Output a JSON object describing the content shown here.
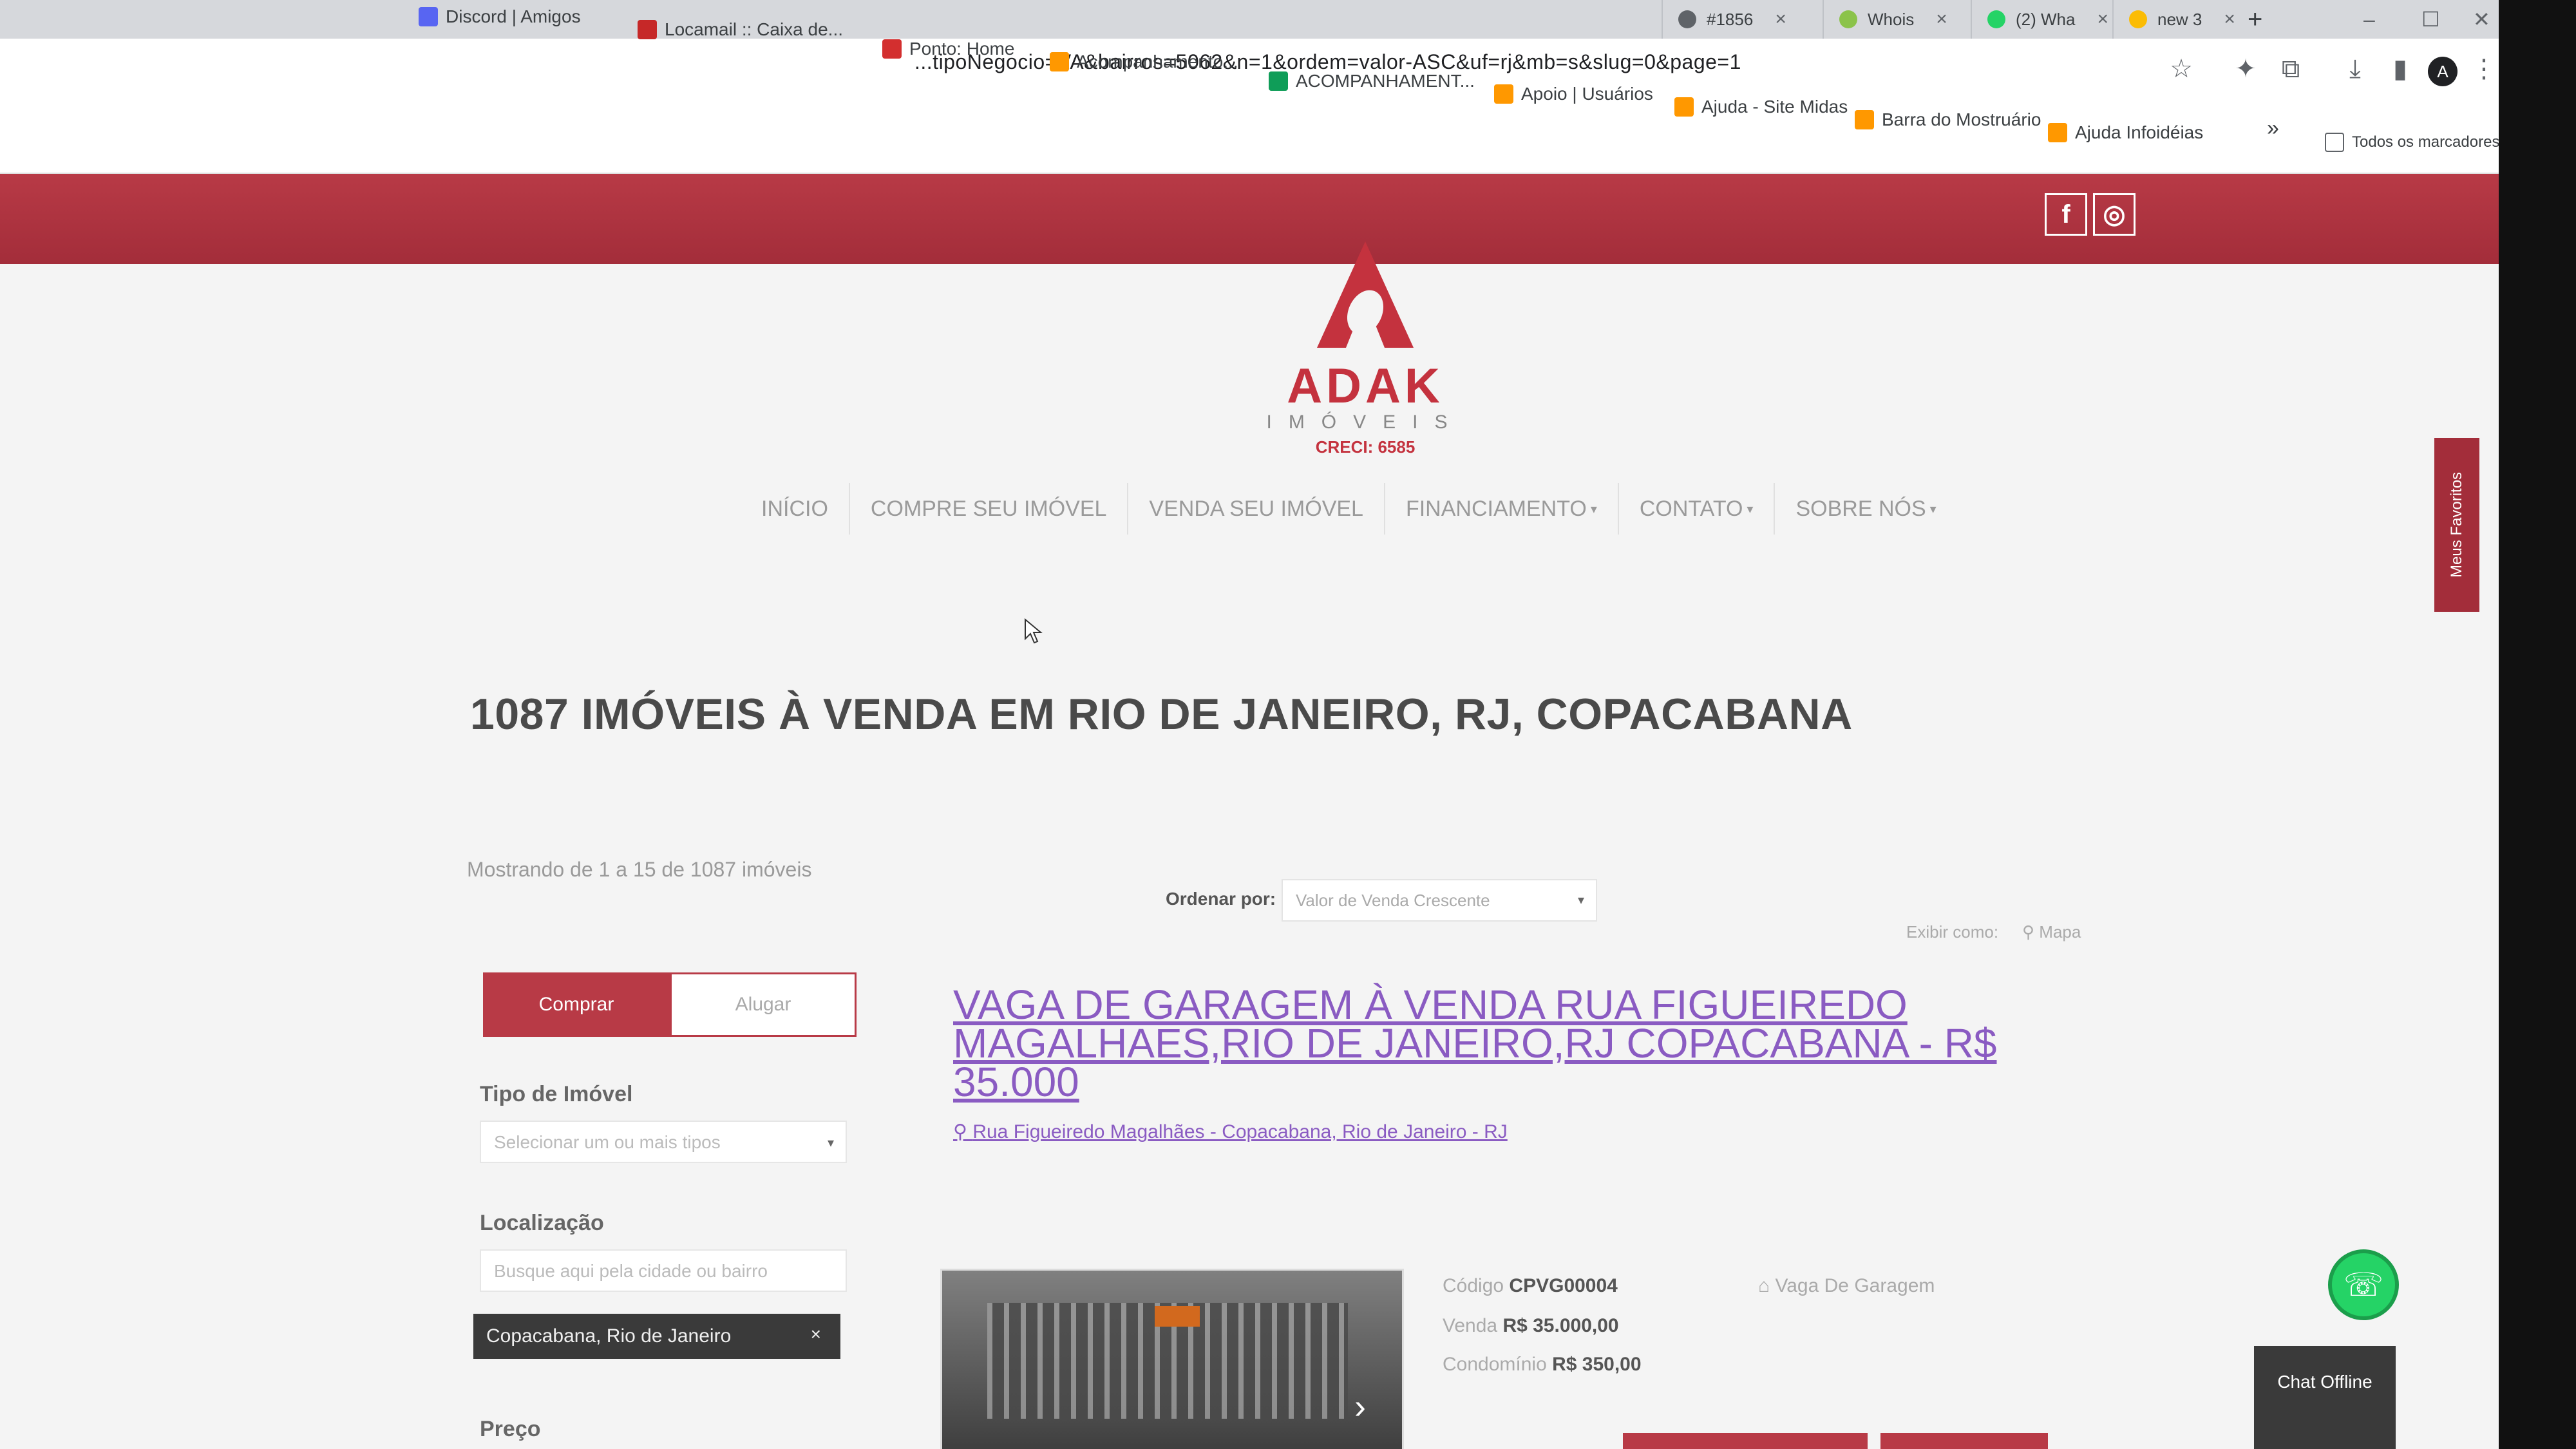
{
  "browser": {
    "tabs": [
      {
        "title": "#1856",
        "close": "×"
      },
      {
        "title": "Whois",
        "close": "×"
      },
      {
        "title": "(2) Wha",
        "close": "×"
      },
      {
        "title": "new 3",
        "close": "×"
      }
    ],
    "new_tab": "+",
    "url": "...tipoNegocio=VA&bairros=5062&n=1&ordem=valor-ASC&uf=rj&mb=s&slug=0&page=1",
    "profile_initial": "A",
    "bookmarks": [
      "Discord | Amigos",
      "Locamail :: Caixa de...",
      "Ponto: Home",
      "Acompanhamento...",
      "ACOMPANHAMENT...",
      "Apoio | Usuários",
      "Ajuda - Site Midas",
      "Barra do Mostruário",
      "Ajuda Infoidéias"
    ],
    "bookmarks_overflow": "»",
    "all_bookmarks": "Todos os marcadores"
  },
  "site": {
    "social": [
      "f",
      "◎"
    ],
    "logo": {
      "name": "ADAK",
      "sub": "IMÓVEIS",
      "creci": "CRECI: 6585"
    },
    "nav": [
      {
        "label": "INÍCIO",
        "dropdown": false
      },
      {
        "label": "COMPRE SEU IMÓVEL",
        "dropdown": false
      },
      {
        "label": "VENDA SEU IMÓVEL",
        "dropdown": false
      },
      {
        "label": "FINANCIAMENTO",
        "dropdown": true
      },
      {
        "label": "CONTATO",
        "dropdown": true
      },
      {
        "label": "SOBRE NÓS",
        "dropdown": true
      }
    ],
    "favorites_tab": "Meus Favoritos"
  },
  "results": {
    "heading": "1087 IMÓVEIS À VENDA EM RIO DE JANEIRO, RJ, COPACABANA",
    "showing": "Mostrando de 1 a 15 de 1087 imóveis",
    "sort_label": "Ordenar por:",
    "sort_value": "Valor de Venda Crescente",
    "view_label": "Exibir como:",
    "view_map": "Mapa"
  },
  "filters": {
    "buy_label": "Comprar",
    "rent_label": "Alugar",
    "type_label": "Tipo de Imóvel",
    "type_placeholder": "Selecionar um ou mais tipos",
    "location_label": "Localização",
    "location_placeholder": "Busque aqui pela cidade ou bairro",
    "location_chip": "Copacabana, Rio de Janeiro",
    "price_label": "Preço"
  },
  "listing": {
    "title": "VAGA DE GARAGEM À VENDA RUA FIGUEIREDO MAGALHAES,RIO DE JANEIRO,RJ COPACABANA - R$ 35.000",
    "address": "Rua Figueiredo Magalhães - Copacabana, Rio de Janeiro - RJ",
    "code_label": "Código",
    "code": "CPVG00004",
    "type": "Vaga De Garagem",
    "sale_label": "Venda",
    "sale_price": "R$ 35.000,00",
    "condo_label": "Condomínio",
    "condo_price": "R$ 350,00"
  },
  "widgets": {
    "chat": "Chat Offline"
  },
  "colors": {
    "brand_red": "#b83a46",
    "link_purple": "#8a5bc2",
    "whatsapp_green": "#25d366"
  }
}
